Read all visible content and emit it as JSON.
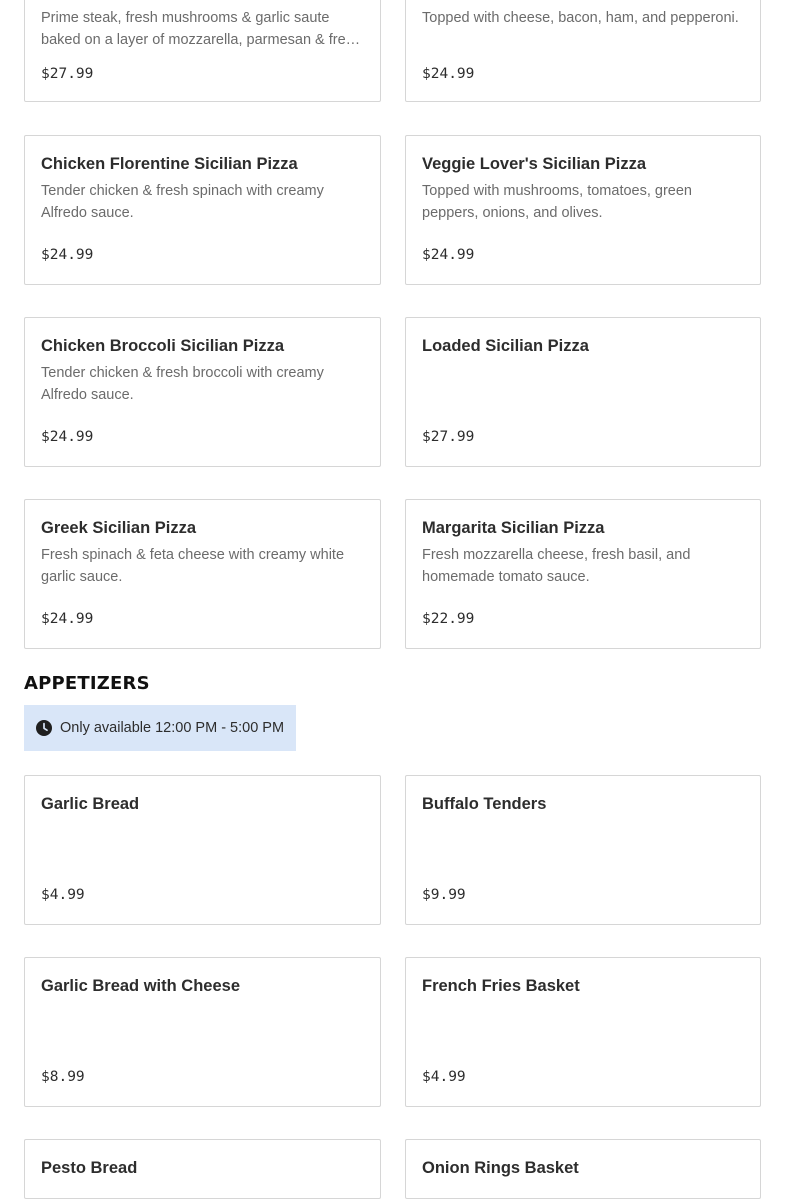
{
  "pizzas": {
    "items": [
      {
        "name": "",
        "description": "Prime steak, fresh mushrooms & garlic saute baked on a layer of mozzarella, parmesan & fresh garlic.",
        "price": "$27.99"
      },
      {
        "name": "",
        "description": "Topped with cheese, bacon, ham, and pepperoni.",
        "price": "$24.99"
      },
      {
        "name": "Chicken Florentine Sicilian Pizza",
        "description": "Tender chicken & fresh spinach with creamy Alfredo sauce.",
        "price": "$24.99"
      },
      {
        "name": "Veggie Lover's Sicilian Pizza",
        "description": "Topped with mushrooms, tomatoes, green peppers, onions, and olives.",
        "price": "$24.99"
      },
      {
        "name": "Chicken Broccoli Sicilian Pizza",
        "description": "Tender chicken & fresh broccoli with creamy Alfredo sauce.",
        "price": "$24.99"
      },
      {
        "name": "Loaded Sicilian Pizza",
        "description": "",
        "price": "$27.99"
      },
      {
        "name": "Greek Sicilian Pizza",
        "description": "Fresh spinach & feta cheese with creamy white garlic sauce.",
        "price": "$24.99"
      },
      {
        "name": "Margarita Sicilian Pizza",
        "description": "Fresh mozzarella cheese, fresh basil, and homemade tomato sauce.",
        "price": "$22.99"
      }
    ]
  },
  "appetizers": {
    "title": "APPETIZERS",
    "availability": {
      "icon": "clock-icon",
      "text": "Only available 12:00 PM - 5:00 PM"
    },
    "items": [
      {
        "name": "Garlic Bread",
        "description": "",
        "price": "$4.99"
      },
      {
        "name": "Buffalo Tenders",
        "description": "",
        "price": "$9.99"
      },
      {
        "name": "Garlic Bread with Cheese",
        "description": "",
        "price": "$8.99"
      },
      {
        "name": "French Fries Basket",
        "description": "",
        "price": "$4.99"
      },
      {
        "name": "Pesto Bread",
        "description": "",
        "price": ""
      },
      {
        "name": "Onion Rings Basket",
        "description": "",
        "price": ""
      }
    ]
  },
  "colors": {
    "card_border": "#d6d6d6",
    "badge_background": "#d9e6f8",
    "description_text": "#6b6b6b",
    "heading_text": "#111111"
  }
}
